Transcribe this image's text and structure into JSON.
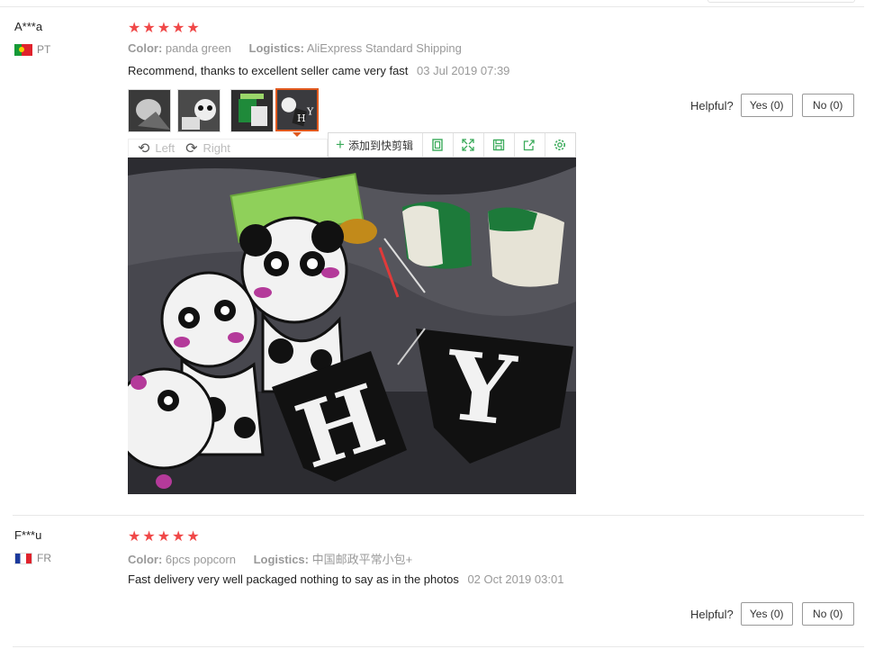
{
  "reviews": [
    {
      "user": "A***a",
      "country": "PT",
      "stars": "★★★★★",
      "color_label": "Color:",
      "color_value": "panda green",
      "logistics_label": "Logistics:",
      "logistics_value": "AliExpress Standard Shipping",
      "text": "Recommend, thanks to excellent seller came very fast",
      "date": "03 Jul 2019 07:39",
      "helpful_label": "Helpful?",
      "yes_label": "Yes (0)",
      "no_label": "No (0)"
    },
    {
      "user": "F***u",
      "country": "FR",
      "stars": "★★★★★",
      "color_label": "Color:",
      "color_value": "6pcs popcorn",
      "logistics_label": "Logistics:",
      "logistics_value": "中国邮政平常小包+",
      "text": "Fast delivery very well packaged nothing to say as in the photos",
      "date": "02 Oct 2019 03:01",
      "helpful_label": "Helpful?",
      "yes_label": "Yes (0)",
      "no_label": "No (0)"
    }
  ],
  "viewer": {
    "rotate_left_label": "Left",
    "rotate_right_label": "Right",
    "add_to_clip_label": "添加到快剪辑",
    "ext_icons": [
      "copy-icon",
      "fullscreen-icon",
      "save-icon",
      "share-icon",
      "settings-icon"
    ]
  },
  "colors": {
    "star": "#f04848",
    "active_thumb_border": "#e0591e",
    "extension_green": "#3aaa5a"
  }
}
